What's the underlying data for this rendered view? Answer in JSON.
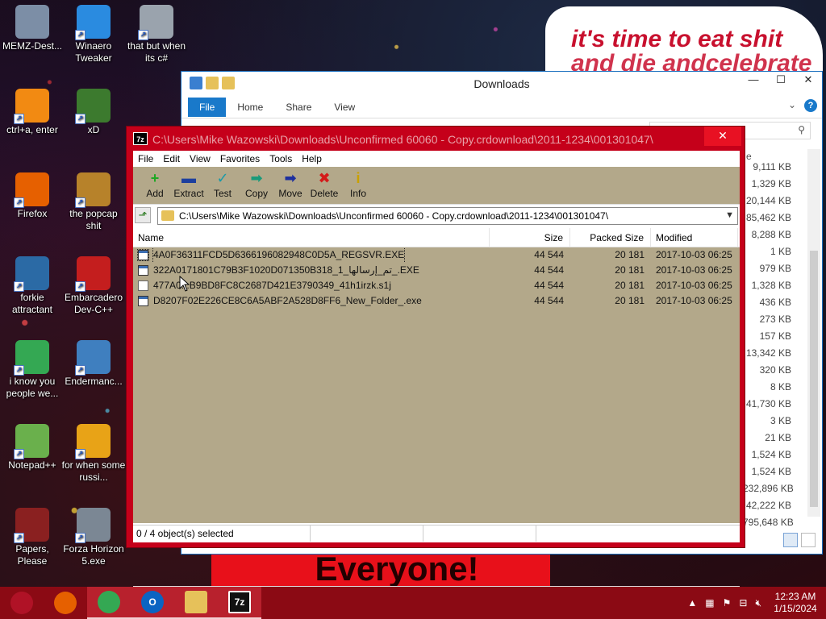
{
  "desktop": {
    "wallpaper_text": "it's time to eat shit",
    "wallpaper_text_2": "and die andcelebrate",
    "billboard_text": "Everyone!",
    "icons": [
      {
        "label": "MEMZ-Dest...",
        "icon": "recycle-bin-icon",
        "color": "#7c8ea6"
      },
      {
        "label": "Winaero Tweaker",
        "icon": "winaero-icon",
        "color": "#2a8be0"
      },
      {
        "label": "that but when its c#",
        "icon": "stacked-windows-icon",
        "color": "#9aa3ad"
      },
      {
        "label": "ctrl+a, enter",
        "icon": "orange-ring-icon",
        "color": "#f28a12"
      },
      {
        "label": "xD",
        "icon": "hxd-icon",
        "color": "#3c7a2e"
      },
      {
        "label": "Firefox",
        "icon": "firefox-icon",
        "color": "#e66000"
      },
      {
        "label": "the popcap shit",
        "icon": "popcap-icon",
        "color": "#b7822a"
      },
      {
        "label": "forkie attractant",
        "icon": "gear-monitor-icon",
        "color": "#2b6aa5"
      },
      {
        "label": "Embarcadero Dev-C++",
        "icon": "devcpp-icon",
        "color": "#c41e1e"
      },
      {
        "label": "i know you people we...",
        "icon": "chrome-icon",
        "color": "#34a853"
      },
      {
        "label": "Endermanc...",
        "icon": "window-icon",
        "color": "#3f7fbf"
      },
      {
        "label": "Notepad++",
        "icon": "notepadpp-icon",
        "color": "#6ab04c"
      },
      {
        "label": "for when some russi...",
        "icon": "de-icon",
        "color": "#e8a317"
      },
      {
        "label": "Papers, Please",
        "icon": "papers-please-icon",
        "color": "#8a2020"
      },
      {
        "label": "Forza Horizon 5.exe",
        "icon": "flash-icon",
        "color": "#7b8794"
      }
    ]
  },
  "explorer": {
    "title": "Downloads",
    "tabs": [
      "File",
      "Home",
      "Share",
      "View"
    ],
    "size_column_header": "e",
    "sizes": [
      "9,111 KB",
      "1,329 KB",
      "20,144 KB",
      "85,462 KB",
      "8,288 KB",
      "1 KB",
      "979 KB",
      "1,328 KB",
      "436 KB",
      "273 KB",
      "157 KB",
      "13,342 KB",
      "320 KB",
      "8 KB",
      "41,730 KB",
      "3 KB",
      "21 KB",
      "1,524 KB",
      "1,524 KB",
      "232,896 KB",
      "42,222 KB",
      "795,648 KB"
    ]
  },
  "sevenzip": {
    "title": "C:\\Users\\Mike Wazowski\\Downloads\\Unconfirmed 60060 - Copy.crdownload\\2011-1234\\001301047\\",
    "menu": [
      "File",
      "Edit",
      "View",
      "Favorites",
      "Tools",
      "Help"
    ],
    "toolbar": [
      {
        "label": "Add",
        "icon": "add-icon",
        "glyph": "+",
        "color": "#1fa824"
      },
      {
        "label": "Extract",
        "icon": "extract-icon",
        "glyph": "▬",
        "color": "#1d3f9e"
      },
      {
        "label": "Test",
        "icon": "test-icon",
        "glyph": "✓",
        "color": "#1a9aa8"
      },
      {
        "label": "Copy",
        "icon": "copy-icon",
        "glyph": "➡",
        "color": "#1a9a7a"
      },
      {
        "label": "Move",
        "icon": "move-icon",
        "glyph": "➡",
        "color": "#1d2f9e"
      },
      {
        "label": "Delete",
        "icon": "delete-icon",
        "glyph": "✖",
        "color": "#d41a1a"
      },
      {
        "label": "Info",
        "icon": "info-icon",
        "glyph": "i",
        "color": "#c9a000"
      }
    ],
    "address": "C:\\Users\\Mike Wazowski\\Downloads\\Unconfirmed 60060 - Copy.crdownload\\2011-1234\\001301047\\",
    "columns": {
      "name": "Name",
      "size": "Size",
      "packed": "Packed Size",
      "modified": "Modified"
    },
    "files": [
      {
        "name": "4A0F36311FCD5D6366196082948C0D5A_REGSVR.EXE",
        "size": "44 544",
        "packed": "20 181",
        "modified": "2017-10-03 06:25",
        "kind": "exe"
      },
      {
        "name": "322A0171801C79B3F1020D071350B318_1_تم_إرسالها_.EXE",
        "size": "44 544",
        "packed": "20 181",
        "modified": "2017-10-03 06:25",
        "kind": "exe"
      },
      {
        "name": "477A0...B9BD8FC8C2687D421E3790349_41h1irzk.s1j",
        "size": "44 544",
        "packed": "20 181",
        "modified": "2017-10-03 06:25",
        "kind": "file"
      },
      {
        "name": "D8207F02E226CE8C6A5ABF2A528D8FF6_New_Folder_.exe",
        "size": "44 544",
        "packed": "20 181",
        "modified": "2017-10-03 06:25",
        "kind": "exe"
      }
    ],
    "status": "0 / 4 object(s) selected"
  },
  "taskbar": {
    "items": [
      {
        "icon": "start-orb-icon",
        "label": "",
        "color": "#b01226"
      },
      {
        "icon": "firefox-taskbar-icon",
        "label": "",
        "color": "#e66000"
      },
      {
        "icon": "chrome-taskbar-icon",
        "label": "",
        "color": "#34a853"
      },
      {
        "icon": "outlook-taskbar-icon",
        "label": "O",
        "color": "#0a64c2"
      },
      {
        "icon": "file-explorer-taskbar-icon",
        "label": "",
        "color": "#e6c15a"
      },
      {
        "icon": "7zip-taskbar-icon",
        "label": "7z",
        "color": "#111111"
      }
    ],
    "time": "12:23 AM",
    "date": "1/15/2024"
  }
}
